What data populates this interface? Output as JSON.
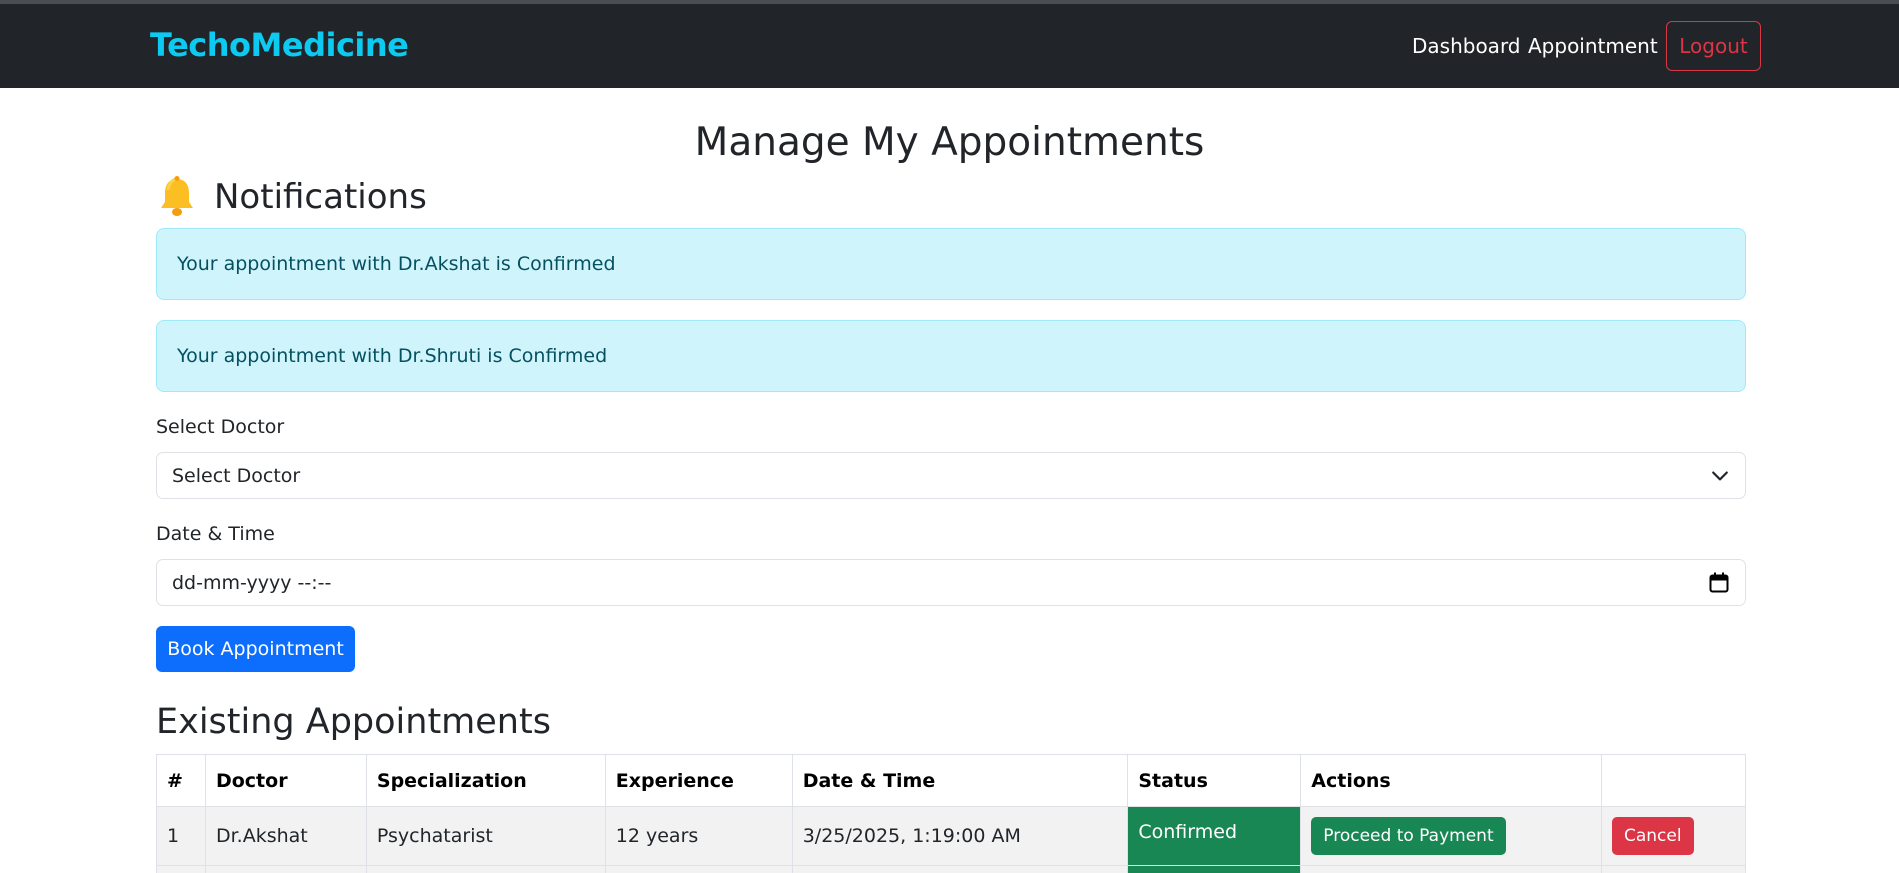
{
  "navbar": {
    "brand": "TechoMedicine",
    "links": [
      "Dashboard",
      "Appointment"
    ],
    "logout_label": "Logout"
  },
  "page": {
    "title": "Manage My Appointments"
  },
  "notifications": {
    "title": "Notifications",
    "icon": "bell-icon",
    "items": [
      "Your appointment with Dr.Akshat is Confirmed",
      "Your appointment with Dr.Shruti is Confirmed"
    ]
  },
  "form": {
    "doctor_label": "Select Doctor",
    "doctor_selected": "Select Doctor",
    "datetime_label": "Date & Time",
    "datetime_placeholder": "dd-mm-yyyy --:--",
    "book_label": "Book Appointment"
  },
  "appointments": {
    "title": "Existing Appointments",
    "columns": [
      "#",
      "Doctor",
      "Specialization",
      "Experience",
      "Date & Time",
      "Status",
      "Actions",
      ""
    ],
    "rows": [
      {
        "num": "1",
        "doctor": "Dr.Akshat",
        "specialization": "Psychatarist",
        "experience": "12 years",
        "datetime": "3/25/2025, 1:19:00 AM",
        "status": "Confirmed",
        "pay_label": "Proceed to Payment",
        "cancel_label": "Cancel"
      }
    ]
  },
  "colors": {
    "navbar_bg": "#212529",
    "brand": "#0dcaf0",
    "logout": "#dc3545",
    "alert_bg": "#cff4fc",
    "alert_text": "#055160",
    "primary": "#0d6efd",
    "success": "#198754",
    "danger": "#dc3545"
  }
}
